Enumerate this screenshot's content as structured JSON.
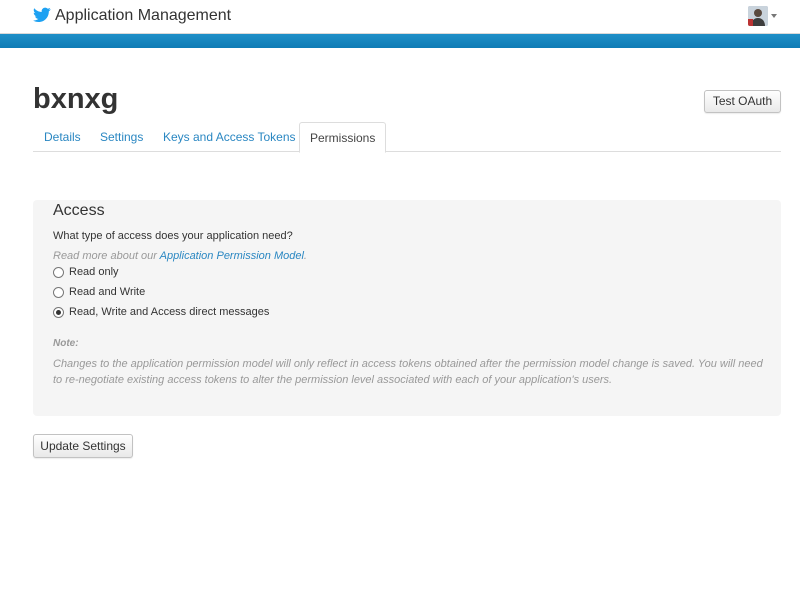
{
  "header": {
    "title": "Application Management",
    "brand_color": "#1da1f2",
    "band_color": "#1585c1",
    "bird_icon": "twitter-bird-icon",
    "avatar_icon": "user-avatar-icon",
    "menu_icon": "caret-down-icon"
  },
  "app": {
    "name": "bxnxg",
    "test_oauth_label": "Test OAuth"
  },
  "tabs": [
    {
      "label": "Details",
      "active": false
    },
    {
      "label": "Settings",
      "active": false
    },
    {
      "label": "Keys and Access Tokens",
      "active": false
    },
    {
      "label": "Permissions",
      "active": true
    }
  ],
  "access": {
    "heading": "Access",
    "question": "What type of access does your application need?",
    "readmore_prefix": "Read more about our ",
    "readmore_link": "Application Permission Model",
    "readmore_suffix": ".",
    "options": [
      {
        "label": "Read only",
        "selected": false
      },
      {
        "label": "Read and Write",
        "selected": false
      },
      {
        "label": "Read, Write and Access direct messages",
        "selected": true
      }
    ],
    "note_label": "Note:",
    "note_text": "Changes to the application permission model will only reflect in access tokens obtained after the permission model change is saved. You will need to re-negotiate existing access tokens to alter the permission level associated with each of your application's users."
  },
  "update_label": "Update Settings"
}
